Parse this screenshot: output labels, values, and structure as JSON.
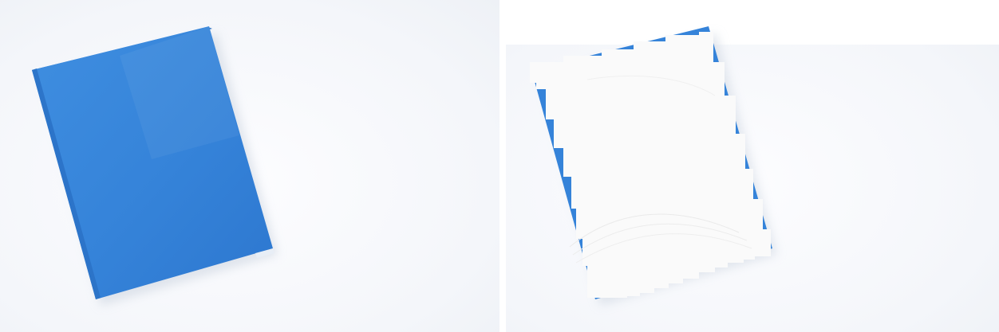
{
  "images": [
    {
      "subject": "blue-notebook-cover",
      "cover_color": "#3a86d8"
    },
    {
      "subject": "notebook-with-white-overlay",
      "cover_color": "#3a86d8",
      "overlay_color": "#fafafa"
    }
  ]
}
